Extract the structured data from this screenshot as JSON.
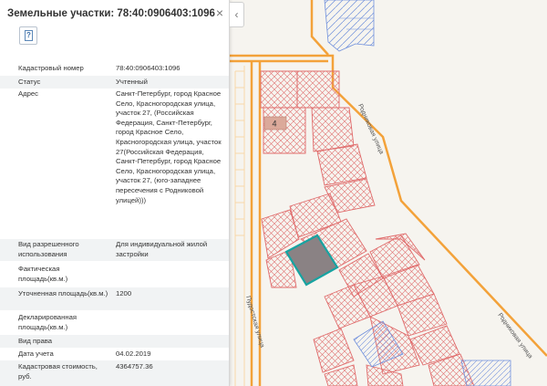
{
  "panel": {
    "title": "Земельные участки: 78:40:0906403:1096",
    "close_glyph": "×",
    "help_glyph": "?",
    "collapse_glyph": "‹",
    "rows": [
      {
        "label": "Кадастровый номер",
        "value": "78:40:0906403:1096"
      },
      {
        "label": "Статус",
        "value": "Учтенный"
      },
      {
        "label": "Адрес",
        "value": "Санкт-Петербург, город Красное Село, Красногородская улица, участок 27, (Российская Федерация, Санкт-Петербург, город Красное Село, Красногородская улица, участок 27(Российская Федерация, Санкт-Петербург, город Красное Село, Красногородская улица, участок 27, (юго-западнее пересечения с Родниковой улицей)))"
      },
      {
        "label": "Вид разрешенного использования",
        "value": "Для индивидуальной жилой застройки"
      },
      {
        "label": "Фактическая площадь(кв.м.)",
        "value": ""
      },
      {
        "label": "Уточненная площадь(кв.м.)",
        "value": "1200"
      },
      {
        "label": "Декларированная площадь(кв.м.)",
        "value": ""
      },
      {
        "label": "Вид права",
        "value": ""
      },
      {
        "label": "Дата учета",
        "value": "04.02.2019"
      },
      {
        "label": "Кадастровая стоимость, руб.",
        "value": "4364757.36"
      }
    ]
  },
  "map": {
    "parcel_label": "4",
    "streets": {
      "rodnikovaya_upper": "Родниковая улица",
      "rodnikovaya_lower": "Родниковая улица",
      "pudostskaya": "Пудостская улица"
    },
    "colors": {
      "road": "#f3a23a",
      "parcel_red": "#e06b6b",
      "parcel_blue": "#6f8fdc",
      "selected_fill": "#8a8284",
      "selected_border": "#17a3a1"
    }
  }
}
